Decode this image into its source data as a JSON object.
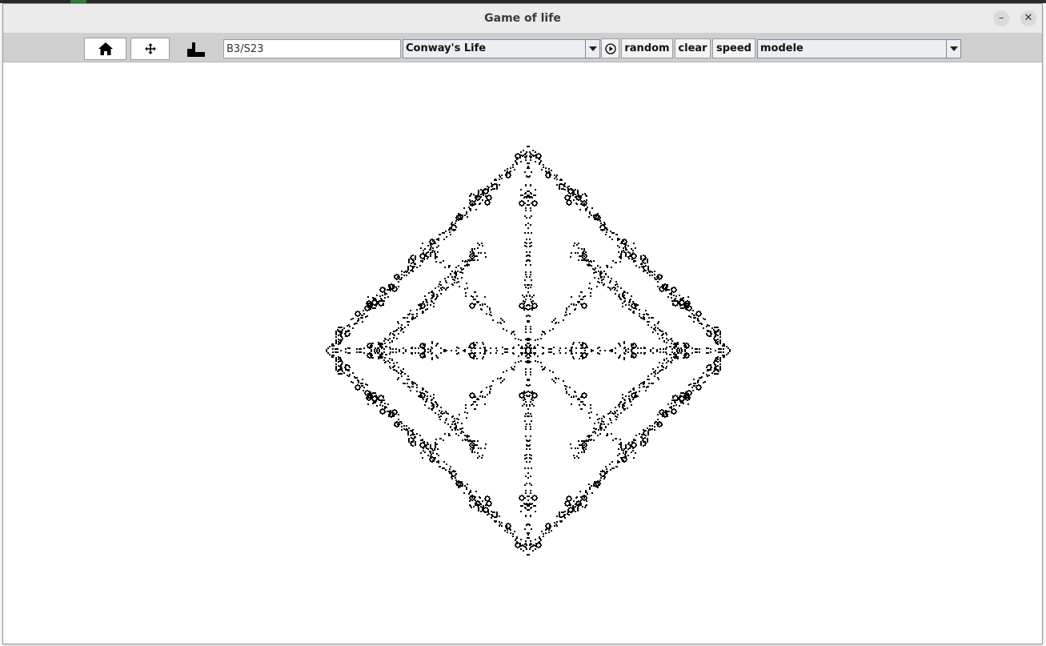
{
  "window": {
    "title": "Game of life"
  },
  "titlebar": {
    "minimize_glyph": "–",
    "close_glyph": "✕"
  },
  "toolbar": {
    "home_icon": "home-icon",
    "move_icon": "move-arrows-icon",
    "stairs_icon": "step-icon",
    "rule_value": "B3/S23",
    "rule_preset": "Conway's Life",
    "run_icon": "play-circle-icon",
    "random_label": "random",
    "clear_label": "clear",
    "speed_label": "speed",
    "model_value": "modele"
  },
  "colors": {
    "toolbar_bg": "#cfcfcf",
    "cell": "#000000",
    "link": "#1a3fc7"
  },
  "board": {
    "pattern": "symmetric diamond",
    "symmetry": "4-fold"
  }
}
